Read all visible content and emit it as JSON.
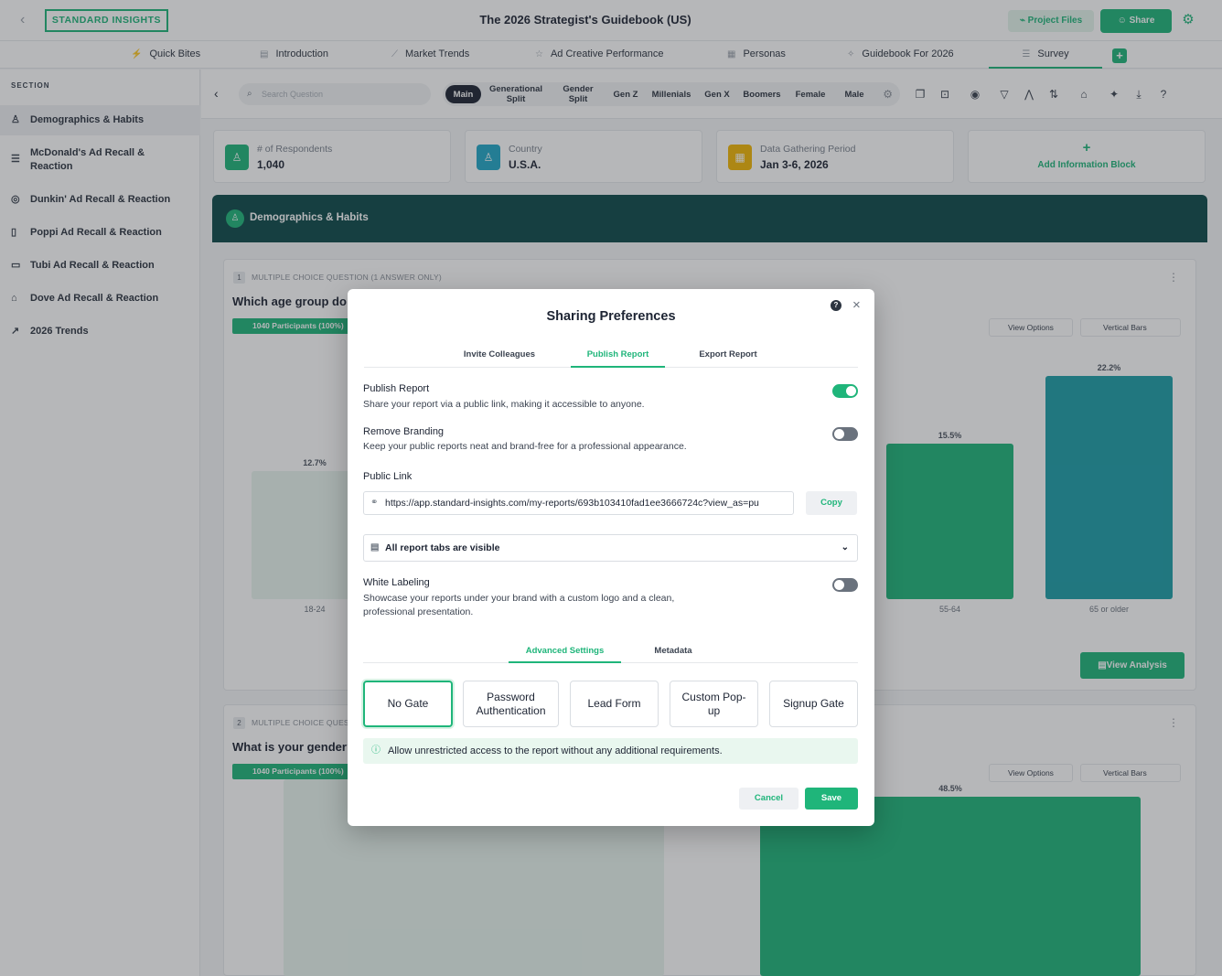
{
  "header": {
    "logo": "STANDARD INSIGHTS",
    "title": "The 2026 Strategist's Guidebook (US)",
    "project_files": "Project Files",
    "share": "Share"
  },
  "tabs": [
    {
      "label": "Quick Bites",
      "icon": "bolt-icon"
    },
    {
      "label": "Introduction",
      "icon": "doc-icon"
    },
    {
      "label": "Market Trends",
      "icon": "trend-icon"
    },
    {
      "label": "Ad Creative Performance",
      "icon": "star-icon"
    },
    {
      "label": "Personas",
      "icon": "persona-icon"
    },
    {
      "label": "Guidebook For 2026",
      "icon": "sparkle-icon"
    },
    {
      "label": "Survey",
      "icon": "list-icon",
      "active": true
    }
  ],
  "sidebar": {
    "section_label": "SECTION",
    "items": [
      {
        "label": "Demographics & Habits",
        "icon": "user-icon",
        "active": true
      },
      {
        "label": "McDonald's Ad Recall & Reaction",
        "icon": "burger-icon"
      },
      {
        "label": "Dunkin' Ad Recall & Reaction",
        "icon": "donut-icon"
      },
      {
        "label": "Poppi Ad Recall & Reaction",
        "icon": "cup-icon"
      },
      {
        "label": "Tubi Ad Recall & Reaction",
        "icon": "tv-icon"
      },
      {
        "label": "Dove Ad Recall & Reaction",
        "icon": "bottle-icon"
      },
      {
        "label": "2026 Trends",
        "icon": "trend-up-icon"
      }
    ]
  },
  "toolbar": {
    "search_placeholder": "Search Question",
    "segments": [
      {
        "label": "Main",
        "active": true
      },
      {
        "label": "Generational Split"
      },
      {
        "label": "Gender Split"
      },
      {
        "label": "Gen Z"
      },
      {
        "label": "Millenials"
      },
      {
        "label": "Gen X"
      },
      {
        "label": "Boomers"
      },
      {
        "label": "Female"
      },
      {
        "label": "Male"
      }
    ]
  },
  "info_blocks": [
    {
      "label": "# of Respondents",
      "value": "1,040",
      "color": "#1fb57a"
    },
    {
      "label": "Country",
      "value": "U.S.A.",
      "color": "#22a8c7"
    },
    {
      "label": "Data Gathering Period",
      "value": "Jan 3-6, 2026",
      "color": "#f2b705"
    }
  ],
  "add_info_block": "Add Information Block",
  "section": {
    "title": "Demographics & Habits"
  },
  "questions": [
    {
      "num": "1",
      "type": "MULTIPLE CHOICE QUESTION (1 ANSWER ONLY)",
      "text": "Which age group do",
      "badge": "1040 Participants (100%)",
      "view_options": "View Options",
      "chart_type": "Vertical Bars"
    },
    {
      "num": "2",
      "type": "MULTIPLE CHOICE QUESTION (1 ANSWER ONLY)",
      "text": "What is your gender?",
      "badge": "1040 Participants (100%)",
      "view_options": "View Options",
      "chart_type": "Vertical Bars"
    }
  ],
  "view_analysis": "View Analysis",
  "chart_data": [
    {
      "type": "bar",
      "categories": [
        "18-24",
        "55-64",
        "65 or older"
      ],
      "values": [
        12.7,
        15.5,
        22.2
      ],
      "value_labels": [
        "12.7%",
        "15.5%",
        "22.2%"
      ],
      "colors": [
        "#e8f5ee",
        "#1fb57a",
        "#1e9ea8"
      ],
      "ylim": [
        0,
        25
      ]
    },
    {
      "type": "bar",
      "categories": [],
      "values": [
        51.5,
        48.5
      ],
      "value_labels": [
        "51.5%",
        "48.5%"
      ],
      "colors": [
        "#e8f5ee",
        "#1fb57a"
      ],
      "ylim": [
        0,
        60
      ]
    }
  ],
  "modal": {
    "title": "Sharing Preferences",
    "tabs": [
      "Invite Colleagues",
      "Publish Report",
      "Export Report"
    ],
    "active_tab": 1,
    "publish": {
      "title": "Publish Report",
      "desc": "Share your report via a public link, making it accessible to anyone.",
      "enabled": true
    },
    "branding": {
      "title": "Remove Branding",
      "desc": "Keep your public reports neat and brand-free for a professional appearance.",
      "enabled": false
    },
    "public_link_label": "Public Link",
    "public_link": "https://app.standard-insights.com/my-reports/693b103410fad1ee3666724c?view_as=pu",
    "copy": "Copy",
    "tabs_visibility": "All report tabs are visible",
    "white_label": {
      "title": "White Labeling",
      "desc": "Showcase your reports under your brand with a custom logo and a clean, professional presentation.",
      "enabled": false
    },
    "sub_tabs": [
      "Advanced Settings",
      "Metadata"
    ],
    "gates": [
      "No Gate",
      "Password Authentication",
      "Lead Form",
      "Custom Pop-up",
      "Signup Gate"
    ],
    "active_gate": 0,
    "gate_info": "Allow unrestricted access to the report without any additional requirements.",
    "cancel": "Cancel",
    "save": "Save"
  }
}
